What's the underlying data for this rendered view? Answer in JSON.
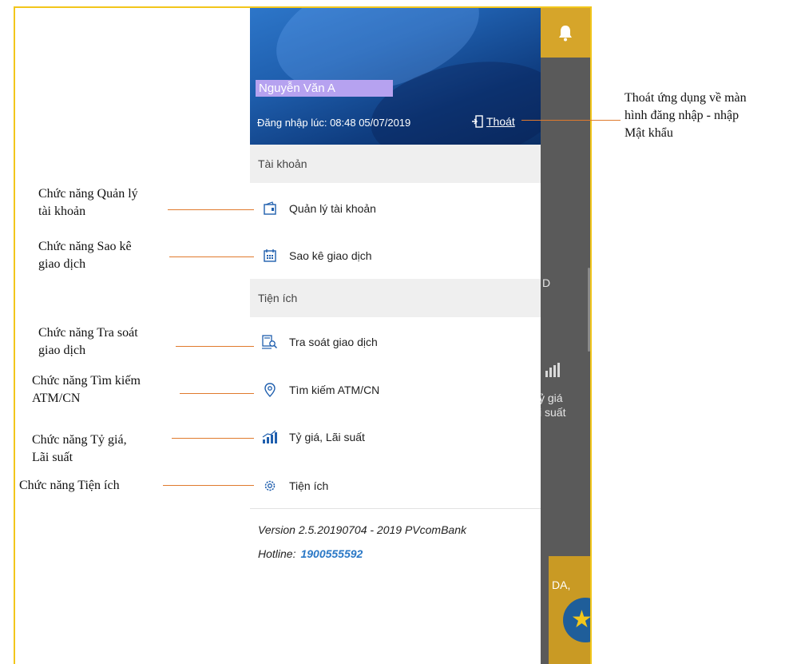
{
  "drawer": {
    "user_name": "Nguyễn Văn A",
    "login_label": "Đăng nhập lúc: 08:48 05/07/2019",
    "logout_label": "Thoát",
    "section_account": "Tài khoản",
    "section_utility": "Tiện ích",
    "items": [
      {
        "label": "Quản lý tài khoản",
        "icon": "wallet-icon"
      },
      {
        "label": "Sao kê giao dịch",
        "icon": "calendar-icon"
      },
      {
        "label": "Tra soát giao dịch",
        "icon": "search-document-icon"
      },
      {
        "label": "Tìm kiếm ATM/CN",
        "icon": "location-pin-icon"
      },
      {
        "label": "Tỷ giá, Lãi suất",
        "icon": "bar-chart-icon"
      },
      {
        "label": "Tiện ích",
        "icon": "gear-icon"
      }
    ],
    "version": "Version 2.5.20190704 - 2019 PVcomBank",
    "hotline_label": "Hotline:",
    "hotline_number": "1900555592"
  },
  "background": {
    "partial_text_1": "D",
    "partial_text_2": "ỷ giá",
    "partial_text_3": "i suất",
    "partial_text_4": "DA,"
  },
  "annotations": {
    "logout_note_1": "Thoát ứng dụng về màn",
    "logout_note_2": "hình đăng nhập - nhập",
    "logout_note_3": "Mật khẩu",
    "account_note_1": "Chức năng Quản lý",
    "account_note_2": "tài khoản",
    "statement_note_1": "Chức năng Sao kê",
    "statement_note_2": "giao dịch",
    "inquiry_note_1": "Chức năng Tra soát",
    "inquiry_note_2": "giao dịch",
    "atm_note_1": "Chức năng Tìm kiếm",
    "atm_note_2": "ATM/CN",
    "rate_note_1": "Chức năng Tỷ giá,",
    "rate_note_2": "Lãi suất",
    "utility_note": "Chức năng Tiện ích"
  },
  "colors": {
    "frame_border": "#f2c61b",
    "header_blue": "#1f5fae",
    "hotline": "#2a78c6",
    "annotation_line": "#e07a2d"
  }
}
